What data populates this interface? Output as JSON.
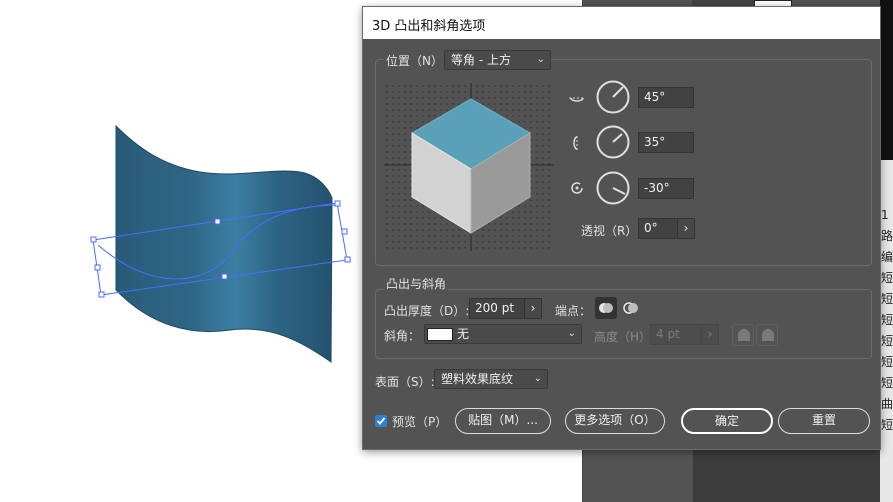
{
  "dialog": {
    "title": "3D 凸出和斜角选项",
    "position": {
      "label": "位置（N）:",
      "preset": "等角 - 上方",
      "x_angle": "45°",
      "y_angle": "35°",
      "z_angle": "-30°",
      "perspective_label": "透视（R）:",
      "perspective_value": "0°"
    },
    "extrude": {
      "group_label": "凸出与斜角",
      "depth_label": "凸出厚度（D）:",
      "depth_value": "200 pt",
      "cap_label": "端点：",
      "bevel_label": "斜角：",
      "bevel_value": "无",
      "height_label": "高度（H）:",
      "height_value": "4 pt"
    },
    "surface": {
      "label": "表面（S）:",
      "value": "塑料效果底纹"
    },
    "footer": {
      "preview_label": "预览（P）",
      "preview_checked": true,
      "map_button": "贴图（M）...",
      "more_options_button": "更多选项（O）",
      "ok_button": "确定",
      "reset_button": "重置"
    }
  },
  "side_panel_chars": [
    "1",
    "路",
    "编",
    "短",
    "短",
    "短",
    "短",
    "短",
    "短",
    "曲",
    "短"
  ],
  "colors": {
    "panel": "#535353",
    "cube_top": "#5aa0b8",
    "shape_fill": "#2f6a8a",
    "selection": "#4a6cff",
    "checkbox": "#2f80d0"
  }
}
